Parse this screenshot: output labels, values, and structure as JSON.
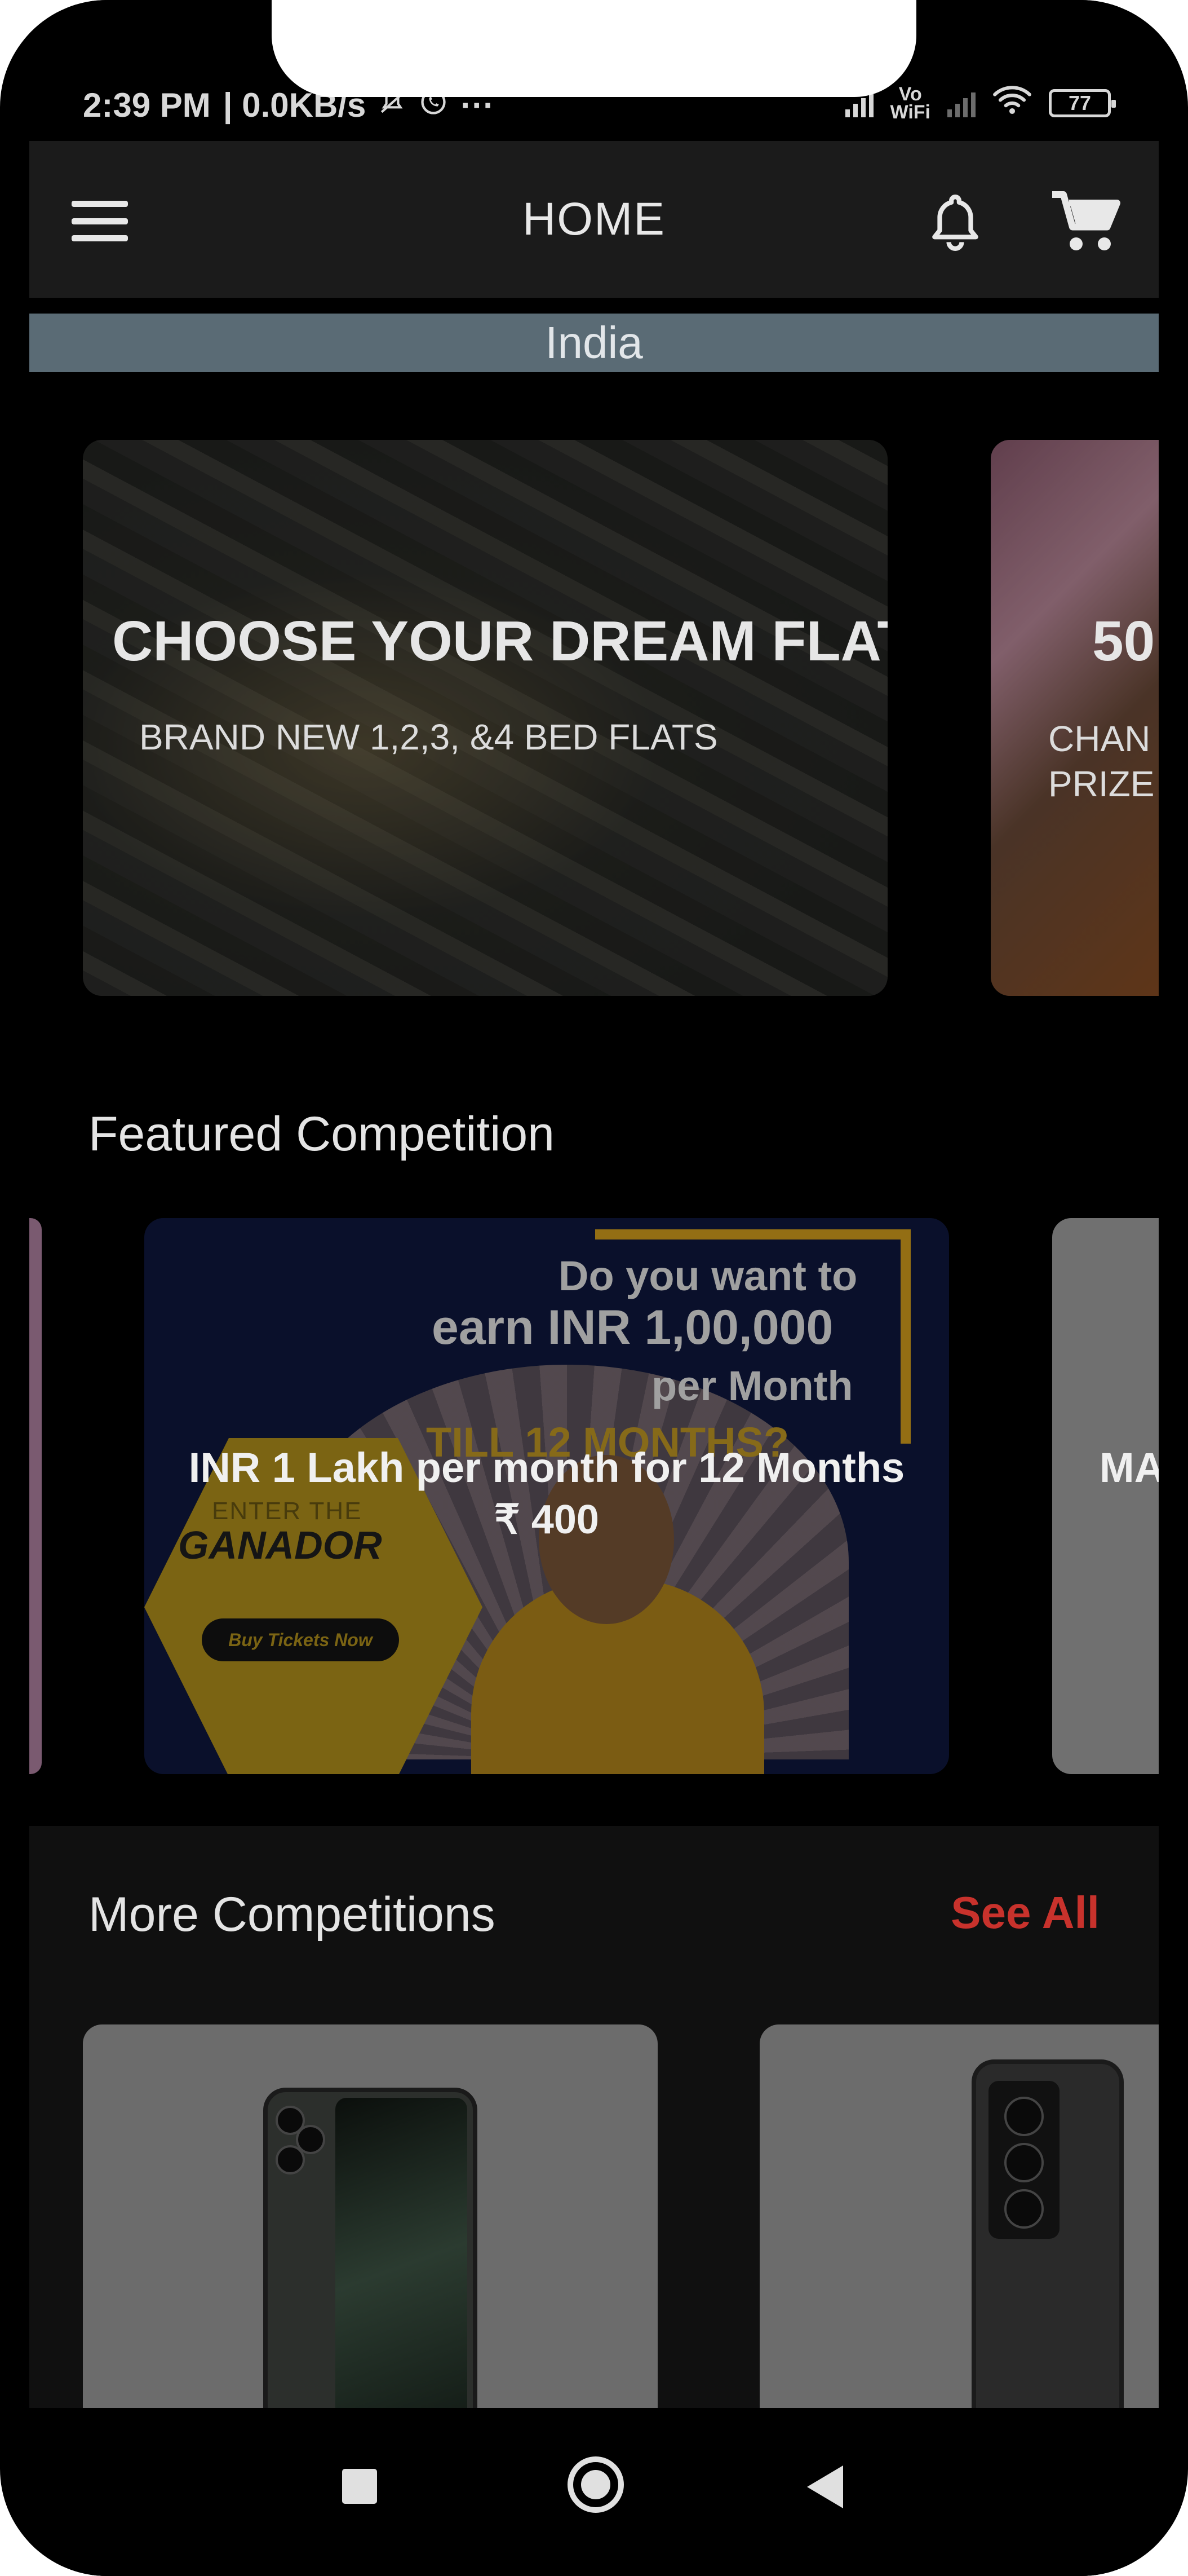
{
  "status_bar": {
    "time": "2:39 PM",
    "net_speed": "| 0.0KB/s",
    "more": "···",
    "wifi_label_1": "Vo",
    "wifi_label_2": "WiFi",
    "battery": "77"
  },
  "app_bar": {
    "title": "HOME",
    "menu_icon": "hamburger-menu-icon",
    "notification_icon": "bell-icon",
    "cart_icon": "shopping-cart-icon"
  },
  "country": "India",
  "banners": [
    {
      "title": "CHOOSE YOUR DREAM FLAT",
      "subtitle": "BRAND NEW 1,2,3, &4 BED FLATS"
    },
    {
      "title": "50",
      "subtitle": "CHAN PRIZE"
    }
  ],
  "featured": {
    "heading": "Featured Competition",
    "items": [
      {
        "title": "INR 1 Lakh per month for 12 Months",
        "price": "₹ 400",
        "ad": {
          "line1": "Do you want to",
          "line2": "earn INR 1,00,000",
          "line3": "per Month",
          "line4": "TILL 12 MONTHS?",
          "line5": "ENTER THE",
          "brand": "GANADOR",
          "cta": "Buy Tickets Now"
        }
      },
      {
        "title": "MA"
      }
    ]
  },
  "more_competitions": {
    "heading": "More Competitions",
    "see_all": "See All"
  },
  "nav_bar": {
    "recents_icon": "square-recents-icon",
    "home_icon": "circle-home-icon",
    "back_icon": "triangle-back-icon"
  }
}
